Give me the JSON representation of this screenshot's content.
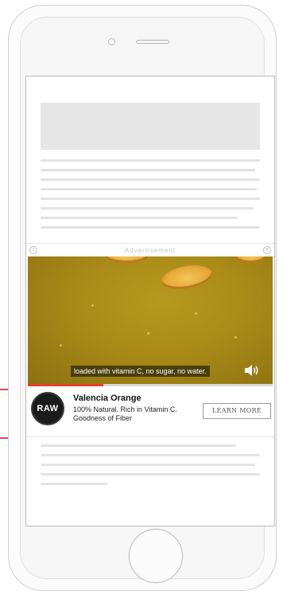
{
  "ad": {
    "label": "Advertisement",
    "info_glyph": "i",
    "close_glyph": "×",
    "caption": "loaded with vitamin C, no sugar, no water.",
    "video_progress_fraction": 0.31,
    "brand_logo_text": "RAW",
    "title": "Valencia Orange",
    "description": "100% Natural. Rich in Vitamin C. Goodness of Fiber",
    "cta_label": "LEARN MORE",
    "icons": {
      "info": "info-icon",
      "close": "close-icon",
      "volume": "speaker-volume-icon"
    }
  },
  "colors": {
    "accent": "#e8402a",
    "annotation": "#e24563",
    "video_bg": "#a98a18"
  }
}
